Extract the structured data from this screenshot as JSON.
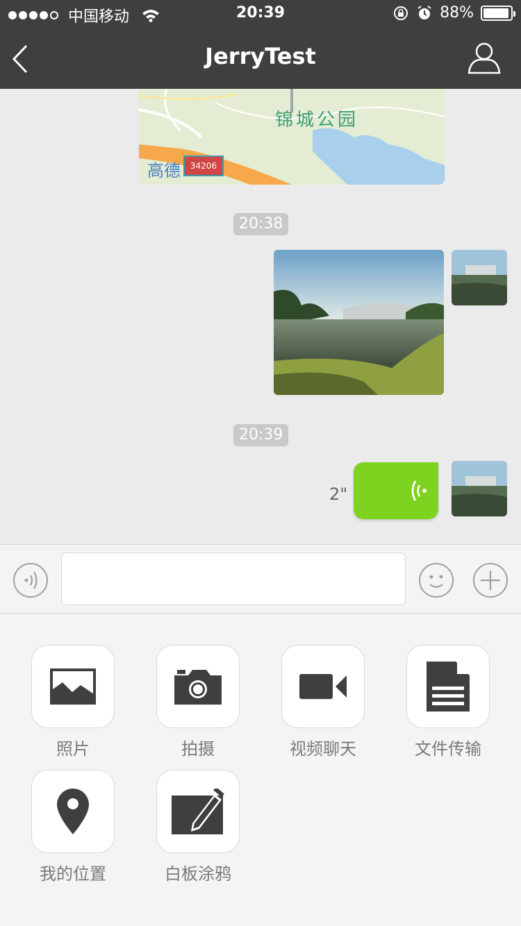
{
  "status_bar": {
    "carrier": "中国移动",
    "time": "20:39",
    "battery": "88%"
  },
  "header": {
    "title": "JerryTest"
  },
  "chat": {
    "map_message": {
      "place_label": "锦城公园",
      "map_brand": "高德",
      "map_plate": "34206"
    },
    "timestamps": [
      "20:38",
      "20:39"
    ],
    "voice_message": {
      "duration": "2\""
    }
  },
  "input_bar": {
    "placeholder": ""
  },
  "panel": {
    "tools": [
      {
        "label": "照片",
        "icon": "photo-icon"
      },
      {
        "label": "拍摄",
        "icon": "camera-icon"
      },
      {
        "label": "视频聊天",
        "icon": "video-icon"
      },
      {
        "label": "文件传输",
        "icon": "file-icon"
      },
      {
        "label": "我的位置",
        "icon": "location-pin-icon"
      },
      {
        "label": "白板涂鸦",
        "icon": "whiteboard-icon"
      }
    ]
  },
  "colors": {
    "header_bg": "#3f3f3f",
    "chat_bg": "#ebebeb",
    "voice_bubble": "#7ed321",
    "icon_dark": "#3f3f3f"
  }
}
